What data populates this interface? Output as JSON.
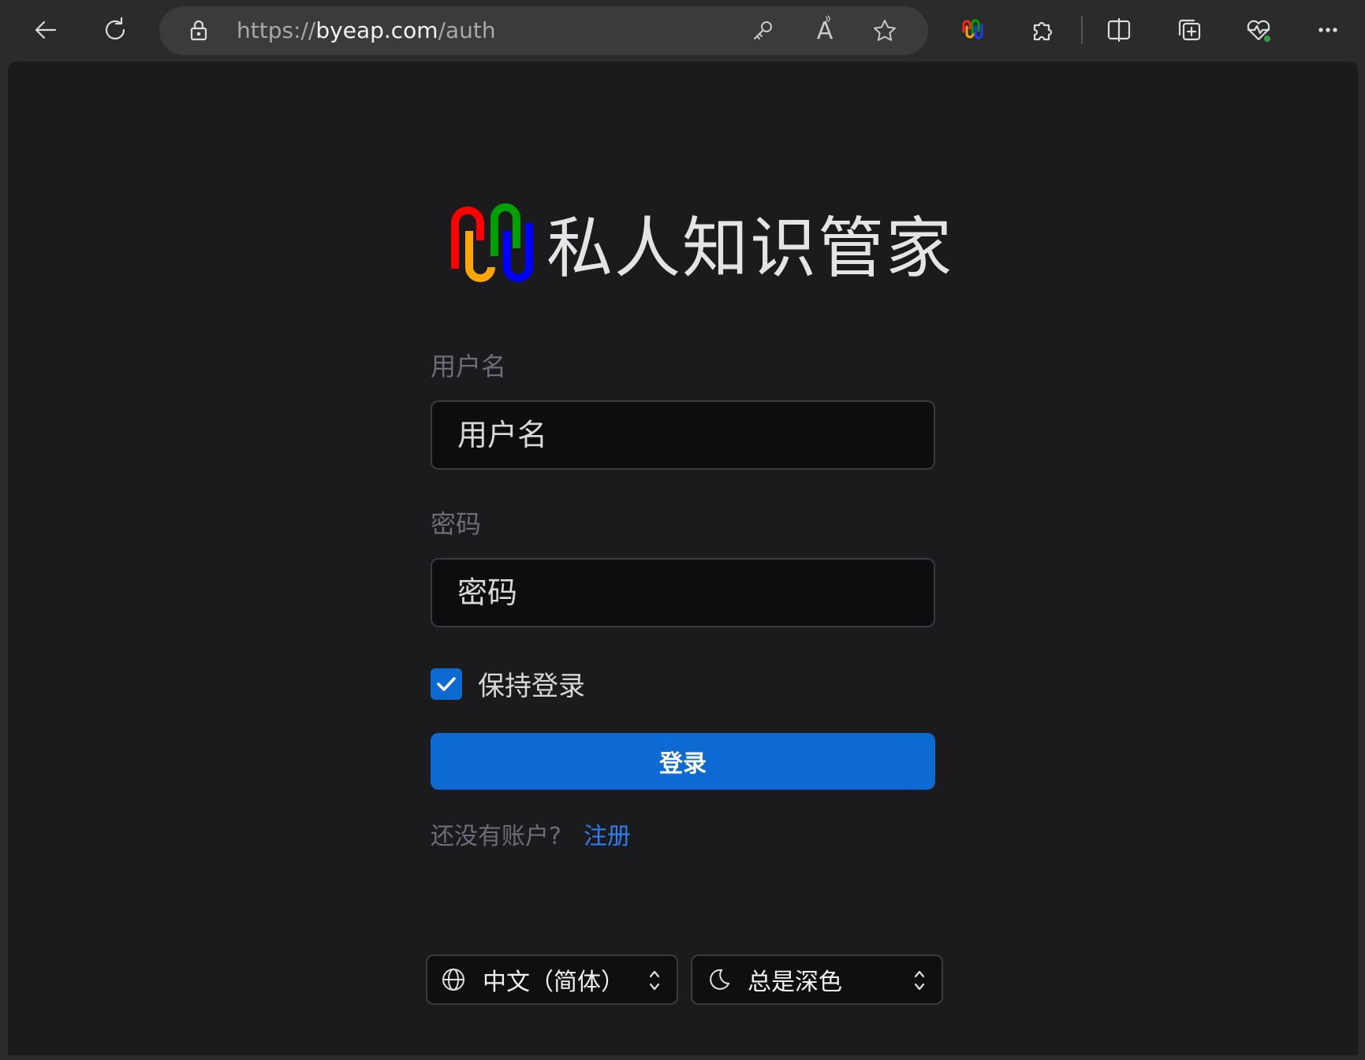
{
  "browser": {
    "url_scheme": "https://",
    "url_host": "byeap.com",
    "url_path": "/auth",
    "read_aloud_glyph": "A"
  },
  "brand": {
    "title": "私人知识管家",
    "logo_colors": [
      "#ff0000",
      "#ffa500",
      "#00a000",
      "#0000ff"
    ]
  },
  "form": {
    "username_label": "用户名",
    "username_placeholder": "用户名",
    "username_value": "",
    "password_label": "密码",
    "password_placeholder": "密码",
    "password_value": "",
    "remember_label": "保持登录",
    "remember_checked": true,
    "login_button": "登录"
  },
  "signup": {
    "question": "还没有账户?",
    "link": "注册"
  },
  "footer": {
    "language": "中文（简体）",
    "theme": "总是深色"
  },
  "colors": {
    "accent": "#0d6ad2",
    "link": "#2e7df2",
    "page_bg": "#1b1b1d"
  }
}
